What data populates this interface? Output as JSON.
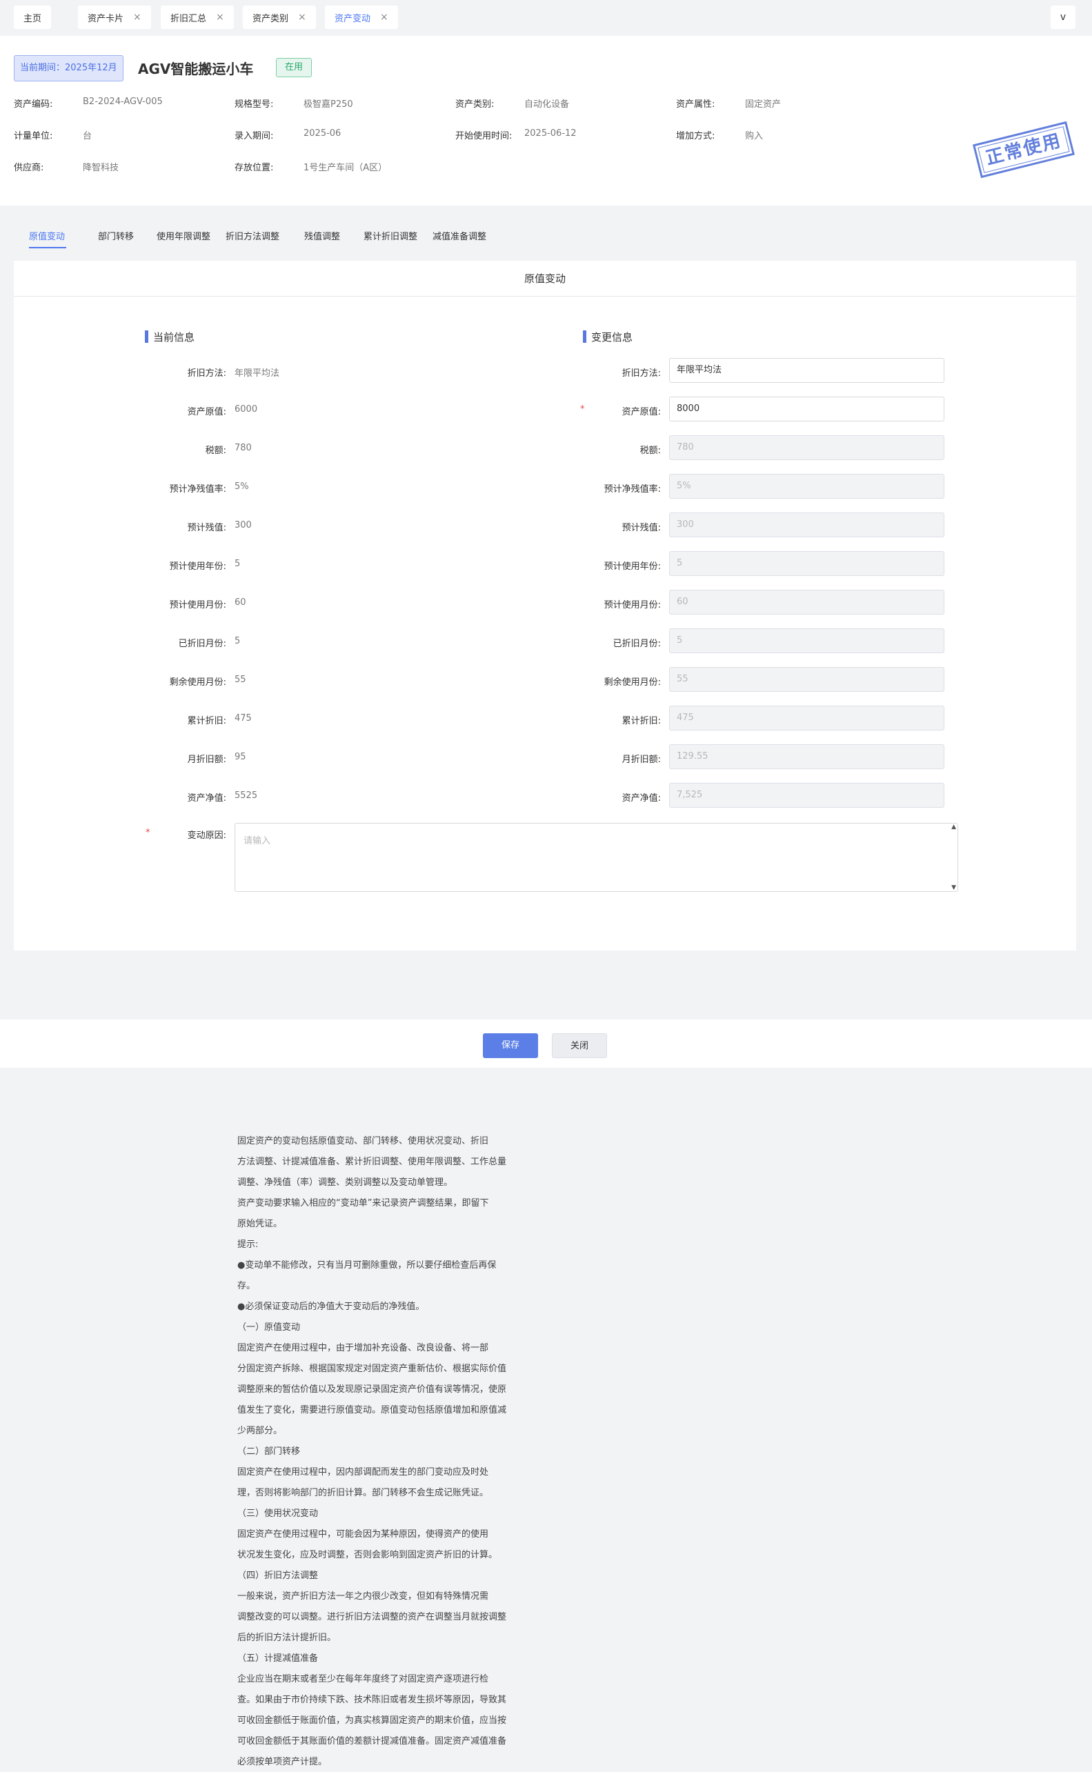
{
  "tabs": [
    {
      "label": "主页",
      "closable": false,
      "active": false
    },
    {
      "label": "资产卡片",
      "closable": true,
      "active": false
    },
    {
      "label": "折旧汇总",
      "closable": true,
      "active": false
    },
    {
      "label": "资产类别",
      "closable": true,
      "active": false
    },
    {
      "label": "资产变动",
      "closable": true,
      "active": true
    }
  ],
  "tab_close_glyph": "×",
  "tab_expand_glyph": "v",
  "header": {
    "period": "当前期间：2025年12月",
    "asset_name": "AGV智能搬运小车",
    "status": "在用",
    "stamp": "正常使用",
    "fields": [
      {
        "label": "资产编码:",
        "value": "B2-2024-AGV-005"
      },
      {
        "label": "规格型号:",
        "value": "极智嘉P250"
      },
      {
        "label": "资产类别:",
        "value": "自动化设备"
      },
      {
        "label": "资产属性:",
        "value": "固定资产"
      },
      {
        "label": "计量单位:",
        "value": "台"
      },
      {
        "label": "录入期间:",
        "value": "2025-06"
      },
      {
        "label": "开始使用时间:",
        "value": "2025-06-12"
      },
      {
        "label": "增加方式:",
        "value": "购入"
      },
      {
        "label": "供应商:",
        "value": "降智科技"
      },
      {
        "label": "存放位置:",
        "value": "1号生产车间（A区）"
      }
    ]
  },
  "subtabs": [
    "原值变动",
    "部门转移",
    "使用年限调整",
    "折旧方法调整",
    "残值调整",
    "累计折旧调整",
    "减值准备调整"
  ],
  "form": {
    "title": "原值变动",
    "current_title": "当前信息",
    "change_title": "变更信息",
    "rows": [
      {
        "label": "折旧方法:",
        "current": "年限平均法",
        "new": "年限平均法",
        "editable": true,
        "required": false
      },
      {
        "label": "资产原值:",
        "current": "6000",
        "new": "8000",
        "editable": true,
        "required": true
      },
      {
        "label": "税额:",
        "current": "780",
        "new": "780",
        "editable": false,
        "required": false
      },
      {
        "label": "预计净残值率:",
        "current": "5%",
        "new": "5%",
        "editable": false,
        "required": false
      },
      {
        "label": "预计残值:",
        "current": "300",
        "new": "300",
        "editable": false,
        "required": false
      },
      {
        "label": "预计使用年份:",
        "current": "5",
        "new": "5",
        "editable": false,
        "required": false
      },
      {
        "label": "预计使用月份:",
        "current": "60",
        "new": "60",
        "editable": false,
        "required": false
      },
      {
        "label": "已折旧月份:",
        "current": "5",
        "new": "5",
        "editable": false,
        "required": false
      },
      {
        "label": "剩余使用月份:",
        "current": "55",
        "new": "55",
        "editable": false,
        "required": false
      },
      {
        "label": "累计折旧:",
        "current": "475",
        "new": "475",
        "editable": false,
        "required": false
      },
      {
        "label": "月折旧额:",
        "current": "95",
        "new": "129.55",
        "editable": false,
        "required": false
      },
      {
        "label": "资产净值:",
        "current": "5525",
        "new": "7,525",
        "editable": false,
        "required": false
      }
    ],
    "reason_label": "变动原因:",
    "reason_placeholder": "请输入",
    "required_mark": "*"
  },
  "actions": {
    "save": "保存",
    "close": "关闭"
  },
  "help_lines": [
    "固定资产的变动包括原值变动、部门转移、使用状况变动、折旧",
    "方法调整、计提减值准备、累计折旧调整、使用年限调整、工作总量",
    "调整、净残值（率）调整、类别调整以及变动单管理。",
    "资产变动要求输入相应的“变动单”来记录资产调整结果，即留下",
    "原始凭证。",
    "提示:",
    "●变动单不能修改，只有当月可删除重做，所以要仔细检查后再保",
    "存。",
    "●必须保证变动后的净值大于变动后的净残值。",
    "（一）原值变动",
    "固定资产在使用过程中，由于增加补充设备、改良设备、将一部",
    "分固定资产拆除、根据国家规定对固定资产重新估价、根据实际价值",
    "调整原来的暂估价值以及发现原记录固定资产价值有误等情况，使原",
    "值发生了变化，需要进行原值变动。原值变动包括原值增加和原值减",
    "少两部分。",
    "（二）部门转移",
    "固定资产在使用过程中，因内部调配而发生的部门变动应及时处",
    "理，否则将影响部门的折旧计算。部门转移不会生成记账凭证。",
    "（三）使用状况变动",
    "固定资产在使用过程中，可能会因为某种原因，使得资产的使用",
    "状况发生变化，应及时调整，否则会影响到固定资产折旧的计算。",
    "（四）折旧方法调整",
    "一般来说，资产折旧方法一年之内很少改变，但如有特殊情况需",
    "调整改变的可以调整。进行折旧方法调整的资产在调整当月就按调整",
    "后的折旧方法计提折旧。",
    "（五）计提减值准备",
    "企业应当在期末或者至少在每年年度终了对固定资产逐项进行检",
    "查。如果由于市价持续下跌、技术陈旧或者发生损坏等原因，导致其",
    "可收回金额低于账面价值，为真实核算固定资产的期末价值，应当按",
    "可收回金额低于其账面价值的差额计提减值准备。固定资产减值准备",
    "必须按单项资产计提。"
  ]
}
